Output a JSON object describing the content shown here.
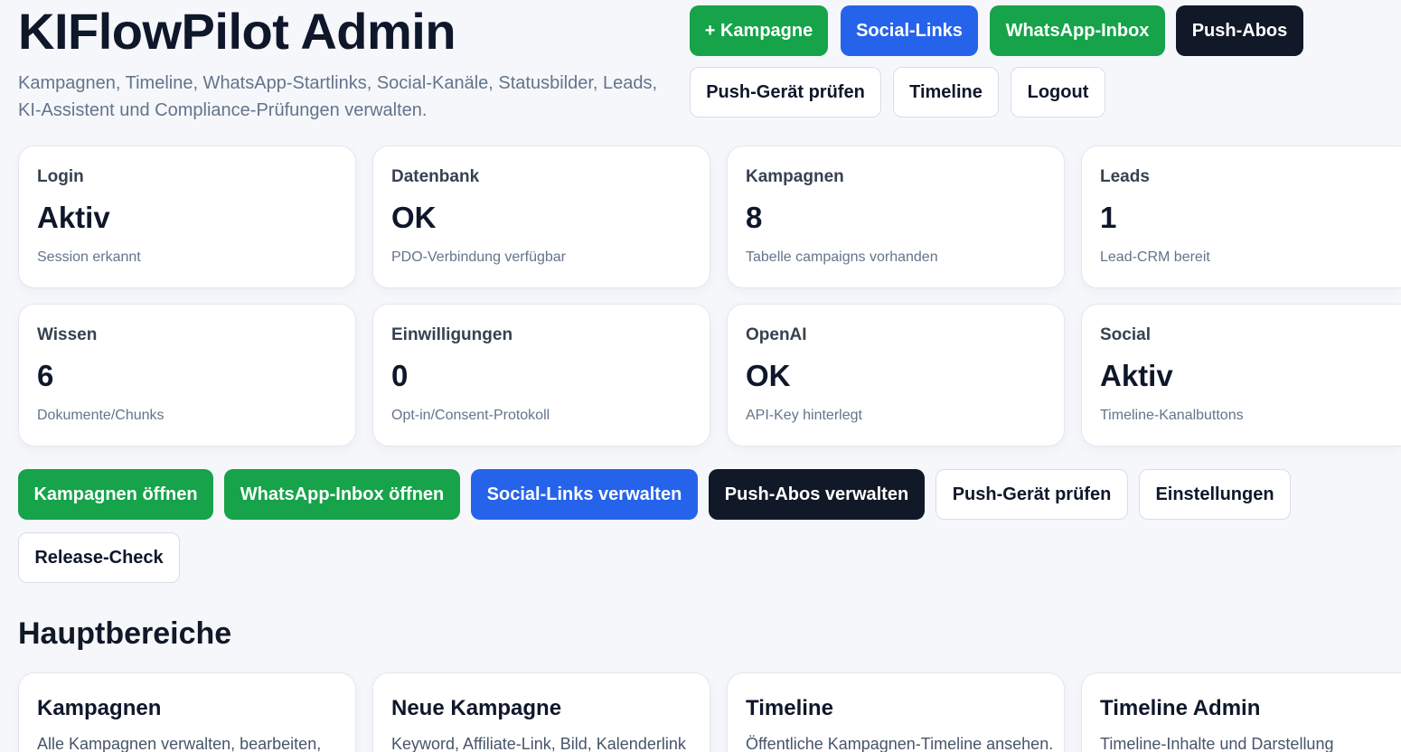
{
  "header": {
    "title": "KIFlowPilot Admin",
    "subtitle": "Kampagnen, Timeline, WhatsApp-Startlinks, Social-Kanäle, Statusbilder, Leads, KI-Assistent und Compliance-Prüfungen verwalten."
  },
  "top_actions": [
    "+ Kampagne",
    "Social-Links",
    "WhatsApp-Inbox",
    "Push-Abos",
    "Push-Gerät prüfen",
    "Timeline",
    "Logout"
  ],
  "status_cards": [
    {
      "label": "Login",
      "value": "Aktiv",
      "sub": "Session erkannt"
    },
    {
      "label": "Datenbank",
      "value": "OK",
      "sub": "PDO-Verbindung verfügbar"
    },
    {
      "label": "Kampagnen",
      "value": "8",
      "sub": "Tabelle campaigns vorhanden"
    },
    {
      "label": "Leads",
      "value": "1",
      "sub": "Lead-CRM bereit"
    },
    {
      "label": "Wissen",
      "value": "6",
      "sub": "Dokumente/Chunks"
    },
    {
      "label": "Einwilligungen",
      "value": "0",
      "sub": "Opt-in/Consent-Protokoll"
    },
    {
      "label": "OpenAI",
      "value": "OK",
      "sub": "API-Key hinterlegt"
    },
    {
      "label": "Social",
      "value": "Aktiv",
      "sub": "Timeline-Kanalbuttons"
    }
  ],
  "quick_actions": [
    "Kampagnen öffnen",
    "WhatsApp-Inbox öffnen",
    "Social-Links verwalten",
    "Push-Abos verwalten",
    "Push-Gerät prüfen",
    "Einstellungen",
    "Release-Check"
  ],
  "main_areas": {
    "title": "Hauptbereiche",
    "items": [
      {
        "title": "Kampagnen",
        "desc": "Alle Kampagnen verwalten, bearbeiten,"
      },
      {
        "title": "Neue Kampagne",
        "desc": "Keyword, Affiliate-Link, Bild, Kalenderlink"
      },
      {
        "title": "Timeline",
        "desc": "Öffentliche Kampagnen-Timeline ansehen."
      },
      {
        "title": "Timeline Admin",
        "desc": "Timeline-Inhalte und Darstellung"
      }
    ]
  },
  "colors": {
    "green": "#16a34a",
    "blue": "#2563eb",
    "dark": "#111827",
    "background": "#f5f7fb"
  }
}
